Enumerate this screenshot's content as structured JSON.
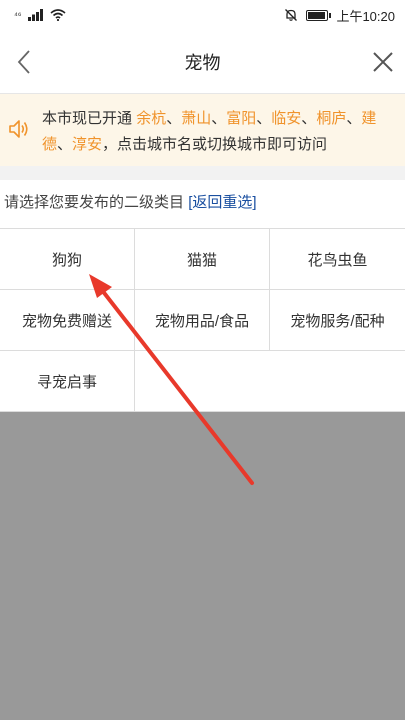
{
  "status_bar": {
    "carrier": "⁴⁶",
    "time": "上午10:20"
  },
  "nav": {
    "title": "宠物"
  },
  "notice": {
    "prefix": "本市现已开通",
    "cities": [
      "余杭",
      "萧山",
      "富阳",
      "临安",
      "桐庐",
      "建德",
      "淳安"
    ],
    "suffix": "，点击城市名或切换城市即可访问",
    "city_color": "#f0932b"
  },
  "prompt": {
    "text": "请选择您要发布的二级类目",
    "reset_label": "[返回重选]"
  },
  "categories": [
    "狗狗",
    "猫猫",
    "花鸟虫鱼",
    "宠物免费赠送",
    "宠物用品/食品",
    "宠物服务/配种",
    "寻宠启事"
  ],
  "colors": {
    "overlay": "#999999",
    "annotation_arrow": "#e8392b",
    "link": "#1a4fa0"
  }
}
